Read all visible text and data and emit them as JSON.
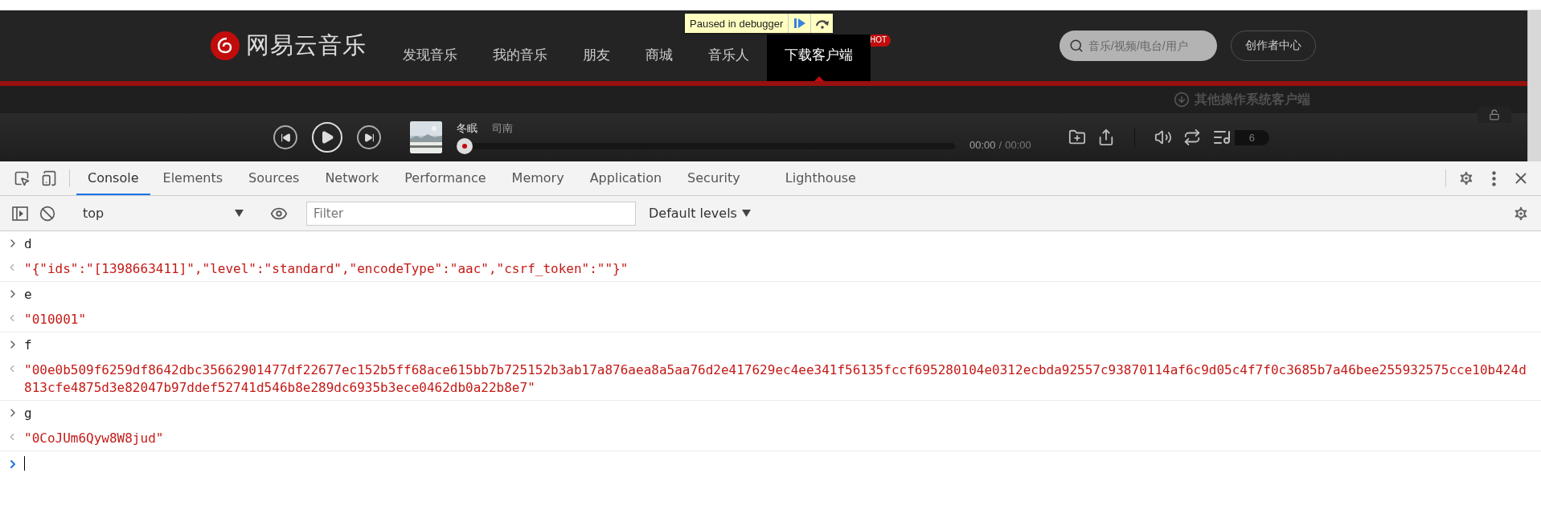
{
  "site": {
    "logo": "网易云音乐",
    "nav": [
      {
        "label": "发现音乐",
        "selected": false
      },
      {
        "label": "我的音乐",
        "selected": false
      },
      {
        "label": "朋友",
        "selected": false
      },
      {
        "label": "商城",
        "selected": false
      },
      {
        "label": "音乐人",
        "selected": false
      },
      {
        "label": "下载客户端",
        "selected": true
      }
    ],
    "hot_badge": "HOT",
    "search": {
      "placeholder": "音乐/视频/电台/用户"
    },
    "creator_button": "创作者中心",
    "download_hint": "其他操作系统客户端"
  },
  "debugger_overlay": {
    "label": "Paused in debugger"
  },
  "player": {
    "song": "冬眠",
    "artist": "司南",
    "level": 0,
    "elapsed": "00:00",
    "separator": "/",
    "duration": "00:00",
    "playlist_count": "6"
  },
  "devtools": {
    "tabs": [
      {
        "label": "Console",
        "selected": true
      },
      {
        "label": "Elements",
        "selected": false
      },
      {
        "label": "Sources",
        "selected": false
      },
      {
        "label": "Network",
        "selected": false
      },
      {
        "label": "Performance",
        "selected": false
      },
      {
        "label": "Memory",
        "selected": false
      },
      {
        "label": "Application",
        "selected": false
      },
      {
        "label": "Security",
        "selected": false
      },
      {
        "label": "Lighthouse",
        "selected": false
      }
    ],
    "context": "top",
    "filter": {
      "placeholder": "Filter"
    },
    "levels": "Default levels",
    "console": [
      {
        "kind": "input",
        "text": "d"
      },
      {
        "kind": "output",
        "text": "\"{\"ids\":\"[1398663411]\",\"level\":\"standard\",\"encodeType\":\"aac\",\"csrf_token\":\"\"}\""
      },
      {
        "kind": "input",
        "text": "e"
      },
      {
        "kind": "output",
        "text": "\"010001\""
      },
      {
        "kind": "input",
        "text": "f"
      },
      {
        "kind": "output",
        "text": "\"00e0b509f6259df8642dbc35662901477df22677ec152b5ff68ace615bb7b725152b3ab17a876aea8a5aa76d2e417629ec4ee341f56135fccf695280104e0312ecbda92557c93870114af6c9d05c4f7f0c3685b7a46bee255932575cce10b424d813cfe4875d3e82047b97ddef52741d546b8e289dc6935b3ece0462db0a22b8e7\""
      },
      {
        "kind": "input",
        "text": "g"
      },
      {
        "kind": "output",
        "text": "\"0CoJUm6Qyw8W8jud\""
      }
    ]
  }
}
